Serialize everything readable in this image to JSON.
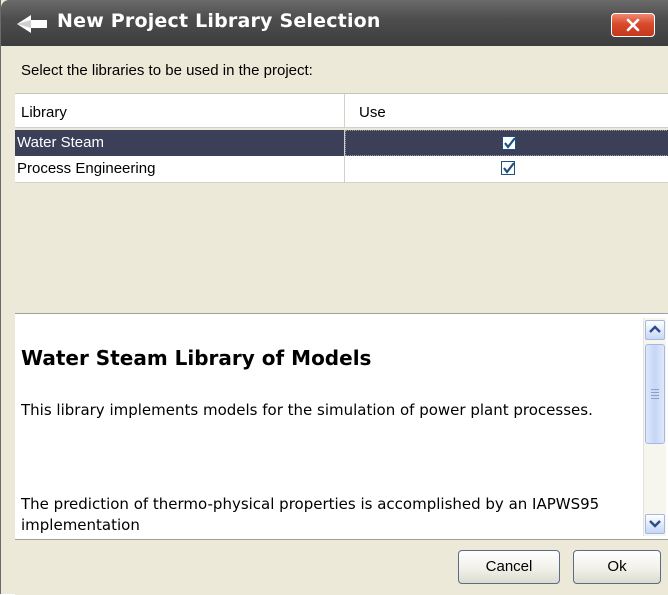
{
  "window": {
    "title": "New Project Library Selection",
    "icon": "back-arrow-icon",
    "close_icon": "close-icon"
  },
  "instruction": "Select the libraries to be used in the project:",
  "table": {
    "columns": [
      "Library",
      "Use"
    ],
    "rows": [
      {
        "library": "Water Steam",
        "use": true,
        "selected": true
      },
      {
        "library": "Process Engineering",
        "use": true,
        "selected": false
      }
    ]
  },
  "description": {
    "heading": "Water Steam Library of Models",
    "paragraph1": "This library implements models for the simulation of power plant processes.",
    "paragraph2": "The prediction of thermo-physical properties is accomplished by an IAPWS95 implementation"
  },
  "buttons": {
    "cancel": "Cancel",
    "ok": "Ok"
  },
  "colors": {
    "titlebar": "#4e4e4e",
    "close_button": "#d84a2c",
    "selected_row": "#3b3f58",
    "background": "#ece9d8"
  }
}
